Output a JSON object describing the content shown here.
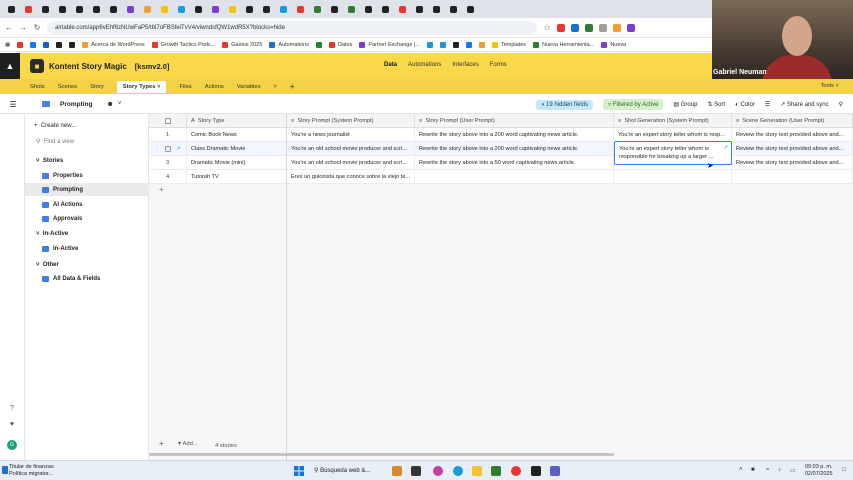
{
  "browser": {
    "url": "airtable.com/app6vEhf6zNUwFaP5/tbl7oFBSfeiTvV4/viwndsfQW1wdR5X?blocks=hide",
    "bookmarks": [
      "Acerca de WordPress",
      "Growth Tactics Podc...",
      "Gastos 2025",
      "Automations",
      "Datos",
      "Partner Exchange |...",
      "Templates",
      "Nueva Herramienta...",
      "Nueva"
    ]
  },
  "app": {
    "base_name": "Kontent Story Magic",
    "version": "[ksmv2.0]",
    "nav": [
      "Data",
      "Automations",
      "Interfaces",
      "Forms"
    ],
    "active_nav": "Data"
  },
  "tables": {
    "tabs": [
      "Shots",
      "Scenes",
      "Story",
      "Story Types",
      "Files",
      "Actions",
      "Variables"
    ],
    "selected": "Story Types",
    "tools_label": "Tools"
  },
  "viewbar": {
    "view_name": "Prompting",
    "hidden_fields": "19 hidden fields",
    "filter": "Filtered by Active",
    "group": "Group",
    "sort": "Sort",
    "color": "Color",
    "share": "Share and sync"
  },
  "sidebar": {
    "create": "Create new...",
    "find": "Find a view",
    "sections": [
      {
        "title": "Stories",
        "items": [
          "Properties",
          "Prompting",
          "AI Actions",
          "Approvals"
        ]
      },
      {
        "title": "In-Active",
        "items": [
          "In-Active"
        ]
      },
      {
        "title": "Other",
        "items": [
          "All Data & Fields"
        ]
      }
    ],
    "selected": "Prompting"
  },
  "grid": {
    "columns": [
      "Story Type",
      "Story Prompt (System Prompt)",
      "Story Prompt (User Prompt)",
      "Shot Generation (System Prompt)",
      "Scene Generation (User Prompt)"
    ],
    "rows": [
      {
        "num": "1",
        "cells": [
          "Comic Book News",
          "You're a news journalist",
          "Rewrite the story above into a 200 word captivating news article.",
          "You're an expert story teller whom is resp...",
          "Review the story text provided above and..."
        ]
      },
      {
        "num": "2",
        "cells": [
          "Class Dramatic Movie",
          "You're an old school movie producer and scri...",
          "Rewrite the story above into a 200 word captivating news article.",
          "",
          "Review the story text provided above and..."
        ]
      },
      {
        "num": "3",
        "cells": [
          "Dramatic Movie (mini)",
          "You're an old school movie producer and scri...",
          "Rewrite the story above into a 50 word captivating news article.",
          "",
          "Review the story text provided above and..."
        ]
      },
      {
        "num": "4",
        "cells": [
          "Tutorah TV",
          "Eres un guionista que conoce sobre la viejo te...",
          "",
          "",
          ""
        ]
      }
    ],
    "editing_cell_text": "You're an expert story teller whom is responsible for breaking up a larger ...",
    "record_count": "4 stories",
    "add_label": "Add..."
  },
  "webcam": {
    "name": "Gabriel Neuman"
  },
  "taskbar": {
    "weather_line1": "Titular de finanzas",
    "weather_line2": "Política migrator...",
    "search": "Búsqueda web &...",
    "time": "09:03 p. m.",
    "date": "02/07/2025"
  },
  "colors": {
    "header": "#f9d84a",
    "accent": "#2d7ff9",
    "view_icon": "#3f7ee8"
  }
}
